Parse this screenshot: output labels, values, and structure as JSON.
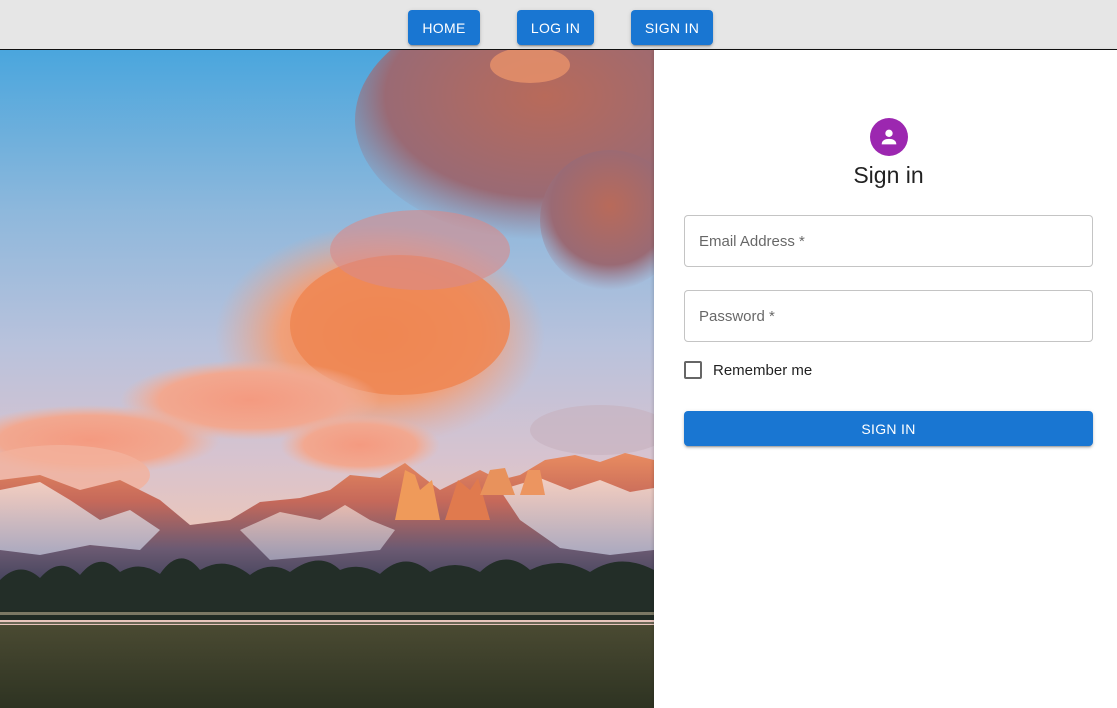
{
  "nav": {
    "home_label": "HOME",
    "login_label": "LOG IN",
    "signin_label": "SIGN IN"
  },
  "background_image": {
    "icon": "landscape-photo",
    "subject": "mountains at sunset"
  },
  "form": {
    "avatar_icon": "person-icon",
    "title": "Sign in",
    "email": {
      "placeholder": "Email Address *",
      "value": ""
    },
    "password": {
      "placeholder": "Password *",
      "value": ""
    },
    "remember_label": "Remember me",
    "remember_checked": false,
    "submit_label": "SIGN IN"
  },
  "colors": {
    "primary": "#1976d2",
    "avatar": "#9c27b0",
    "nav_background": "#e6e6e6"
  }
}
